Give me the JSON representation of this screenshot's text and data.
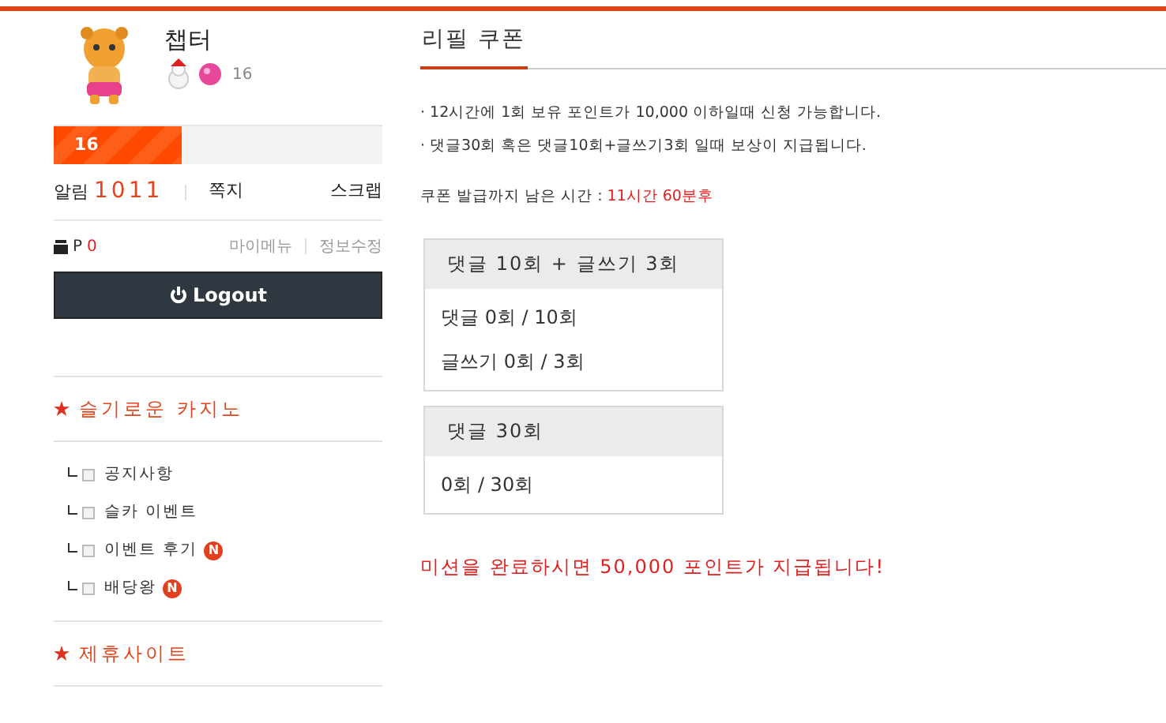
{
  "profile": {
    "name": "챕터",
    "level_badge": "16",
    "level_bar": {
      "label": "16",
      "level": 0.39
    }
  },
  "links": {
    "alarm_label": "알림",
    "alarm_count": "1011",
    "message": "쪽지",
    "scrap": "스크랩"
  },
  "points": {
    "label": "P",
    "value": "0",
    "my_menu": "마이메뉴",
    "edit_info": "정보수정"
  },
  "logout_button": "Logout",
  "sections": [
    {
      "title": "슬기로운 카지노",
      "items": [
        {
          "label": "공지사항"
        },
        {
          "label": "슬카 이벤트"
        },
        {
          "label": "이벤트 후기",
          "new_badge": "N"
        },
        {
          "label": "배당왕",
          "new_badge": "N"
        }
      ]
    },
    {
      "title": "제휴사이트"
    }
  ],
  "page": {
    "title": "리필 쿠폰",
    "notes": [
      "· 12시간에 1회 보유 포인트가 10,000 이하일때 신청 가능합니다.",
      "· 댓글30회 혹은 댓글10회+글쓰기3회 일때 보상이 지급됩니다."
    ],
    "timer_label": "쿠폰 발급까지 남은 시간 :",
    "timer_value": "11시간 60분후",
    "missions": [
      {
        "title": "댓글 10회 + 글쓰기 3회",
        "lines": [
          "댓글 0회 / 10회",
          "글쓰기 0회 / 3회"
        ]
      },
      {
        "title": "댓글 30회",
        "lines": [
          "0회 / 30회"
        ]
      }
    ],
    "reward": "미션을 완료하시면 50,000 포인트가 지급됩니다!"
  }
}
